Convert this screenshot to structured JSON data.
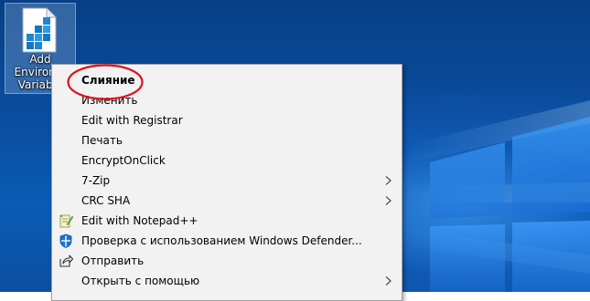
{
  "desktop": {
    "icon": {
      "label_lines": [
        "Add",
        "Environm",
        "Variable"
      ],
      "icon_name": "registry-file-icon"
    }
  },
  "context_menu": {
    "items": [
      {
        "label": "Слияние",
        "default": true,
        "icon": "",
        "submenu": false
      },
      {
        "label": "Изменить",
        "default": false,
        "icon": "",
        "submenu": false
      },
      {
        "label": "Edit with Registrar",
        "default": false,
        "icon": "",
        "submenu": false
      },
      {
        "label": "Печать",
        "default": false,
        "icon": "",
        "submenu": false
      },
      {
        "label": "EncryptOnClick",
        "default": false,
        "icon": "",
        "submenu": false
      },
      {
        "label": "7-Zip",
        "default": false,
        "icon": "",
        "submenu": true
      },
      {
        "label": "CRC SHA",
        "default": false,
        "icon": "",
        "submenu": true
      },
      {
        "label": "Edit with Notepad++",
        "default": false,
        "icon": "notepad-plus-plus-icon",
        "submenu": false
      },
      {
        "label": "Проверка с использованием Windows Defender...",
        "default": false,
        "icon": "windows-defender-icon",
        "submenu": false
      },
      {
        "label": "Отправить",
        "default": false,
        "icon": "share-icon",
        "submenu": false
      },
      {
        "label": "Открыть с помощью",
        "default": false,
        "icon": "",
        "submenu": true
      }
    ]
  },
  "colors": {
    "annotation": "#e0101a",
    "menu_background": "#f2f2f2",
    "desktop_blue": "#0a4d9e"
  }
}
